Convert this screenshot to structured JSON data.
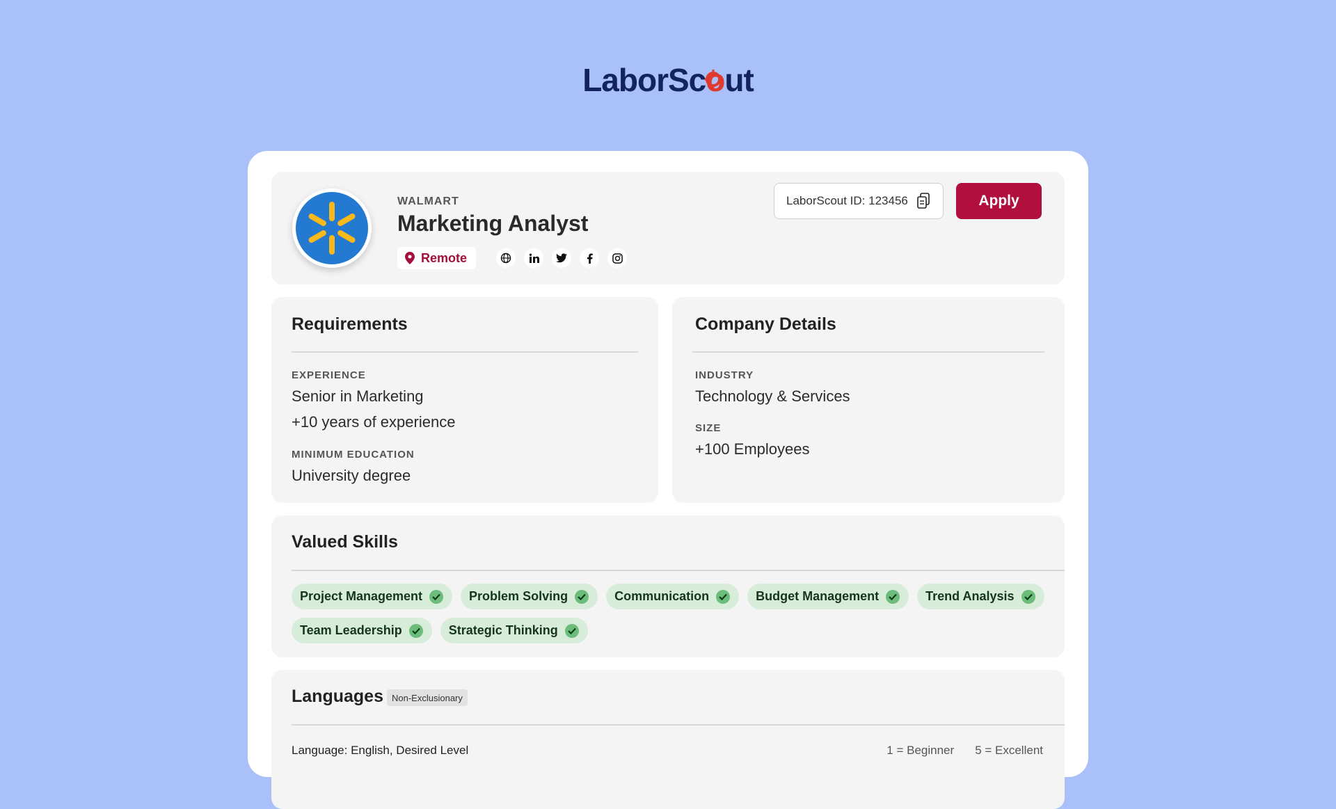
{
  "brand": {
    "logo_prefix": "LaborSc",
    "logo_o": "o",
    "logo_suffix": "ut"
  },
  "job": {
    "company": "WALMART",
    "title": "Marketing Analyst",
    "location": "Remote",
    "laborscout_id": "LaborScout ID: 123456",
    "apply_label": "Apply",
    "socials": [
      "globe-icon",
      "linkedin-icon",
      "twitter-icon",
      "facebook-icon",
      "instagram-icon"
    ]
  },
  "requirements": {
    "title": "Requirements",
    "experience_label": "EXPERIENCE",
    "experience_line1": "Senior in Marketing",
    "experience_line2": "+10 years of experience",
    "education_label": "MINIMUM EDUCATION",
    "education_value": "University degree"
  },
  "company_details": {
    "title": "Company Details",
    "industry_label": "INDUSTRY",
    "industry_value": "Technology & Services",
    "size_label": "SIZE",
    "size_value": "+100 Employees"
  },
  "skills": {
    "title": "Valued Skills",
    "items": [
      "Project Management",
      "Problem Solving",
      "Communication",
      "Budget Management",
      "Trend Analysis",
      "Team Leadership",
      "Strategic Thinking"
    ]
  },
  "languages": {
    "title": "Languages",
    "badge": "Non-Exclusionary",
    "row_text": "Language: English, Desired Level",
    "legend_low": "1 = Beginner",
    "legend_high": "5 = Excellent"
  },
  "colors": {
    "background": "#a9c0f8",
    "accent": "#b10f3e",
    "brand_navy": "#13235e",
    "brand_red": "#e0392e",
    "walmart_blue": "#2479d0",
    "walmart_yellow": "#f9b81b",
    "skill_bg": "#d8ecda"
  }
}
